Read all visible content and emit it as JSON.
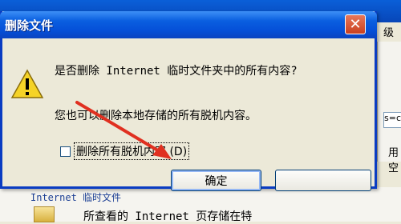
{
  "background": {
    "top_right_text": "级",
    "field_text": "s=c",
    "side_text": "用空",
    "section_label": "Internet 临时文件",
    "row_text": "所查看的 Internet 页存储在特"
  },
  "dialog": {
    "title": "删除文件",
    "close_glyph": "✕",
    "message_primary": "是否删除 Internet 临时文件夹中的所有内容?",
    "message_secondary": "您也可以删除本地存储的所有脱机内容。",
    "checkbox_label": "删除所有脱机内容 (D)",
    "checkbox_checked": false,
    "ok_label": "确定",
    "cancel_label": ""
  },
  "colors": {
    "titlebar": "#0550d8",
    "close_button": "#c9401f",
    "annotation_arrow": "#e03020"
  },
  "icons": {
    "dialog_icon": "warning-icon",
    "close": "close-icon"
  }
}
